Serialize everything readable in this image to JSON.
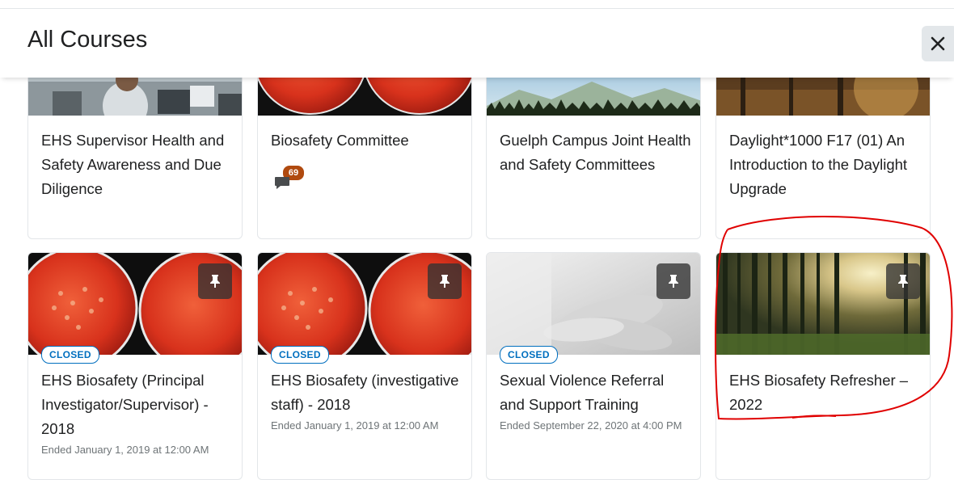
{
  "dialog": {
    "title": "All Courses",
    "close_label": "Close"
  },
  "courses": [
    {
      "title": "EHS Supervisor Health and Safety Awareness and Due Diligence",
      "image": "office-people"
    },
    {
      "title": "Biosafety Committee",
      "image": "petri-dishes",
      "notification_count": "69"
    },
    {
      "title": "Guelph Campus Joint Health and Safety Committees",
      "image": "mountains-forest"
    },
    {
      "title": "Daylight*1000 F17 (01) An Introduction to the Daylight Upgrade",
      "image": "sunlit-forest"
    },
    {
      "title": "EHS Biosafety (Principal Investigator/Supervisor) - 2018",
      "badge": "CLOSED",
      "ended": "Ended January 1, 2019 at 12:00 AM",
      "image": "petri-dishes"
    },
    {
      "title": "EHS Biosafety (investigative staff) - 2018",
      "badge": "CLOSED",
      "ended": "Ended January 1, 2019 at 12:00 AM",
      "image": "petri-dishes"
    },
    {
      "title": "Sexual Violence Referral and Support Training",
      "badge": "CLOSED",
      "ended": "Ended September 22, 2020 at 4:00 PM",
      "image": "hands-grayscale"
    },
    {
      "title": "EHS Biosafety Refresher – 2022",
      "image": "sunlit-forest"
    }
  ],
  "colors": {
    "badge": "#006fbf",
    "notification": "#b04a0f",
    "annotation": "#e00000"
  }
}
